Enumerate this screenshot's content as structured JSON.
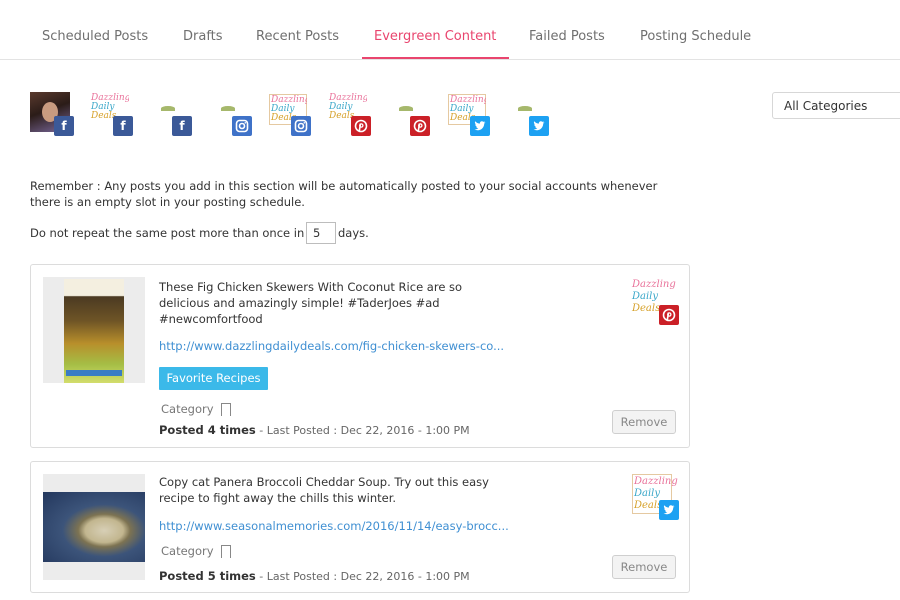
{
  "tabs": [
    {
      "label": "Scheduled Posts",
      "active": false
    },
    {
      "label": "Drafts",
      "active": false
    },
    {
      "label": "Recent Posts",
      "active": false
    },
    {
      "label": "Evergreen Content",
      "active": true
    },
    {
      "label": "Failed Posts",
      "active": false
    },
    {
      "label": "Posting Schedule",
      "active": false
    }
  ],
  "accent_color": "#e9456e",
  "accounts": [
    {
      "avatar": "profile-photo",
      "network": "facebook"
    },
    {
      "avatar": "dazzling-daily-deals-logo",
      "network": "facebook"
    },
    {
      "avatar": "seasonal-memories-logo",
      "network": "facebook"
    },
    {
      "avatar": "seasonal-memories-logo",
      "network": "instagram"
    },
    {
      "avatar": "dazzling-daily-deals-logo",
      "network": "instagram"
    },
    {
      "avatar": "dazzling-daily-deals-logo",
      "network": "pinterest"
    },
    {
      "avatar": "seasonal-memories-logo",
      "network": "pinterest"
    },
    {
      "avatar": "dazzling-daily-deals-logo",
      "network": "twitter"
    },
    {
      "avatar": "seasonal-memories-logo",
      "network": "twitter"
    }
  ],
  "logo_text": {
    "line1": "Dazzling",
    "line2": "Daily",
    "line3": "Deals"
  },
  "category_filter": {
    "selected": "All Categories"
  },
  "notice": {
    "remember": "Remember : Any posts you add in this section will be automatically posted to your social accounts whenever there is an empty slot in your posting schedule.",
    "repeat_prefix": "Do not repeat the same post more than once in",
    "repeat_value": "5",
    "repeat_suffix": "days."
  },
  "posts": [
    {
      "text": "These Fig Chicken Skewers With Coconut Rice are so delicious and amazingly simple! #TaderJoes #ad #newcomfortfood",
      "link": "http://www.dazzlingdailydeals.com/fig-chicken-skewers-co...",
      "category_tag": "Favorite Recipes",
      "category_label": "Category",
      "posted_count": "Posted 4 times",
      "last_posted": " - Last Posted : Dec 22, 2016 - 1:00 PM",
      "remove_label": "Remove",
      "network": "pinterest"
    },
    {
      "text": "Copy cat Panera Broccoli Cheddar Soup. Try out this easy recipe to fight away the chills this winter.",
      "link": "http://www.seasonalmemories.com/2016/11/14/easy-brocc...",
      "category_label": "Category",
      "posted_count": "Posted 5 times",
      "last_posted": " - Last Posted : Dec 22, 2016 - 1:00 PM",
      "remove_label": "Remove",
      "network": "twitter"
    }
  ]
}
